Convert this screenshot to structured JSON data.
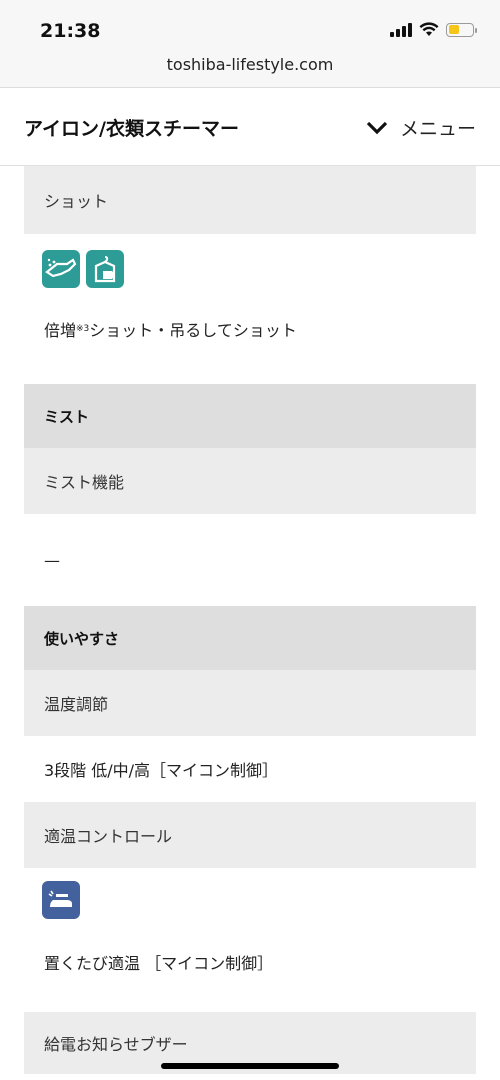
{
  "status_bar": {
    "time": "21:38",
    "battery_color": "#f5c518"
  },
  "browser": {
    "url": "toshiba-lifestyle.com"
  },
  "header": {
    "title": "アイロン/衣類スチーマー",
    "menu_label": "メニュー",
    "menu_icon": "chevron-down-icon"
  },
  "spec": {
    "shot": {
      "label": "ショット",
      "icons": [
        "double-shot-icon",
        "hanging-shot-icon"
      ],
      "value_prefix": "倍増",
      "value_sup": "※3",
      "value_rest": "ショット・吊るしてショット"
    },
    "mist_section": "ミスト",
    "mist": {
      "label": "ミスト機能",
      "value": "—"
    },
    "usability_section": "使いやすさ",
    "temperature": {
      "label": "温度調節",
      "value": "3段階 低/中/高［マイコン制御］"
    },
    "temp_control": {
      "label": "適温コントロール",
      "icon": "iron-temperature-icon",
      "value": "置くたび適温 ［マイコン制御］"
    },
    "buzzer": {
      "label": "給電お知らせブザー",
      "icon": "speaker-buzzer-icon"
    }
  },
  "colors": {
    "teal_icon": "#2e9c96",
    "blue_icon": "#43629d",
    "label_bg": "#ececec",
    "section_bg": "#dedede"
  }
}
